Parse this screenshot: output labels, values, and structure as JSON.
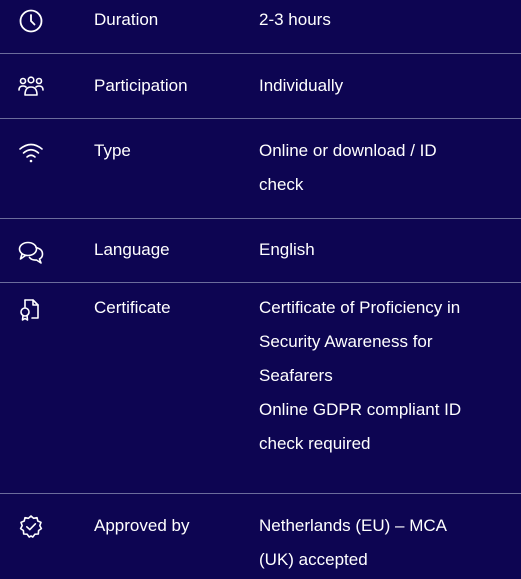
{
  "rows": [
    {
      "key": "duration",
      "icon": "clock-icon",
      "label": "Duration",
      "value_lines": [
        "2-3 hours"
      ]
    },
    {
      "key": "participation",
      "icon": "people-icon",
      "label": "Participation",
      "value_lines": [
        "Individually"
      ]
    },
    {
      "key": "type",
      "icon": "wifi-icon",
      "label": "Type",
      "value_lines": [
        "Online or download / ID",
        "check"
      ]
    },
    {
      "key": "language",
      "icon": "chat-bubbles-icon",
      "label": "Language",
      "value_lines": [
        "English"
      ]
    },
    {
      "key": "certificate",
      "icon": "certificate-icon",
      "label": "Certificate",
      "value_lines": [
        "Certificate of Proficiency in",
        "Security Awareness for",
        "Seafarers",
        "Online GDPR compliant ID",
        "check required"
      ]
    },
    {
      "key": "approved_by",
      "icon": "badge-check-icon",
      "label": "Approved by",
      "value_lines": [
        "Netherlands (EU) – MCA",
        "(UK) accepted"
      ]
    }
  ],
  "colors": {
    "background": "#0d0552",
    "text": "#ffffff",
    "divider": "#6b6c9c"
  }
}
